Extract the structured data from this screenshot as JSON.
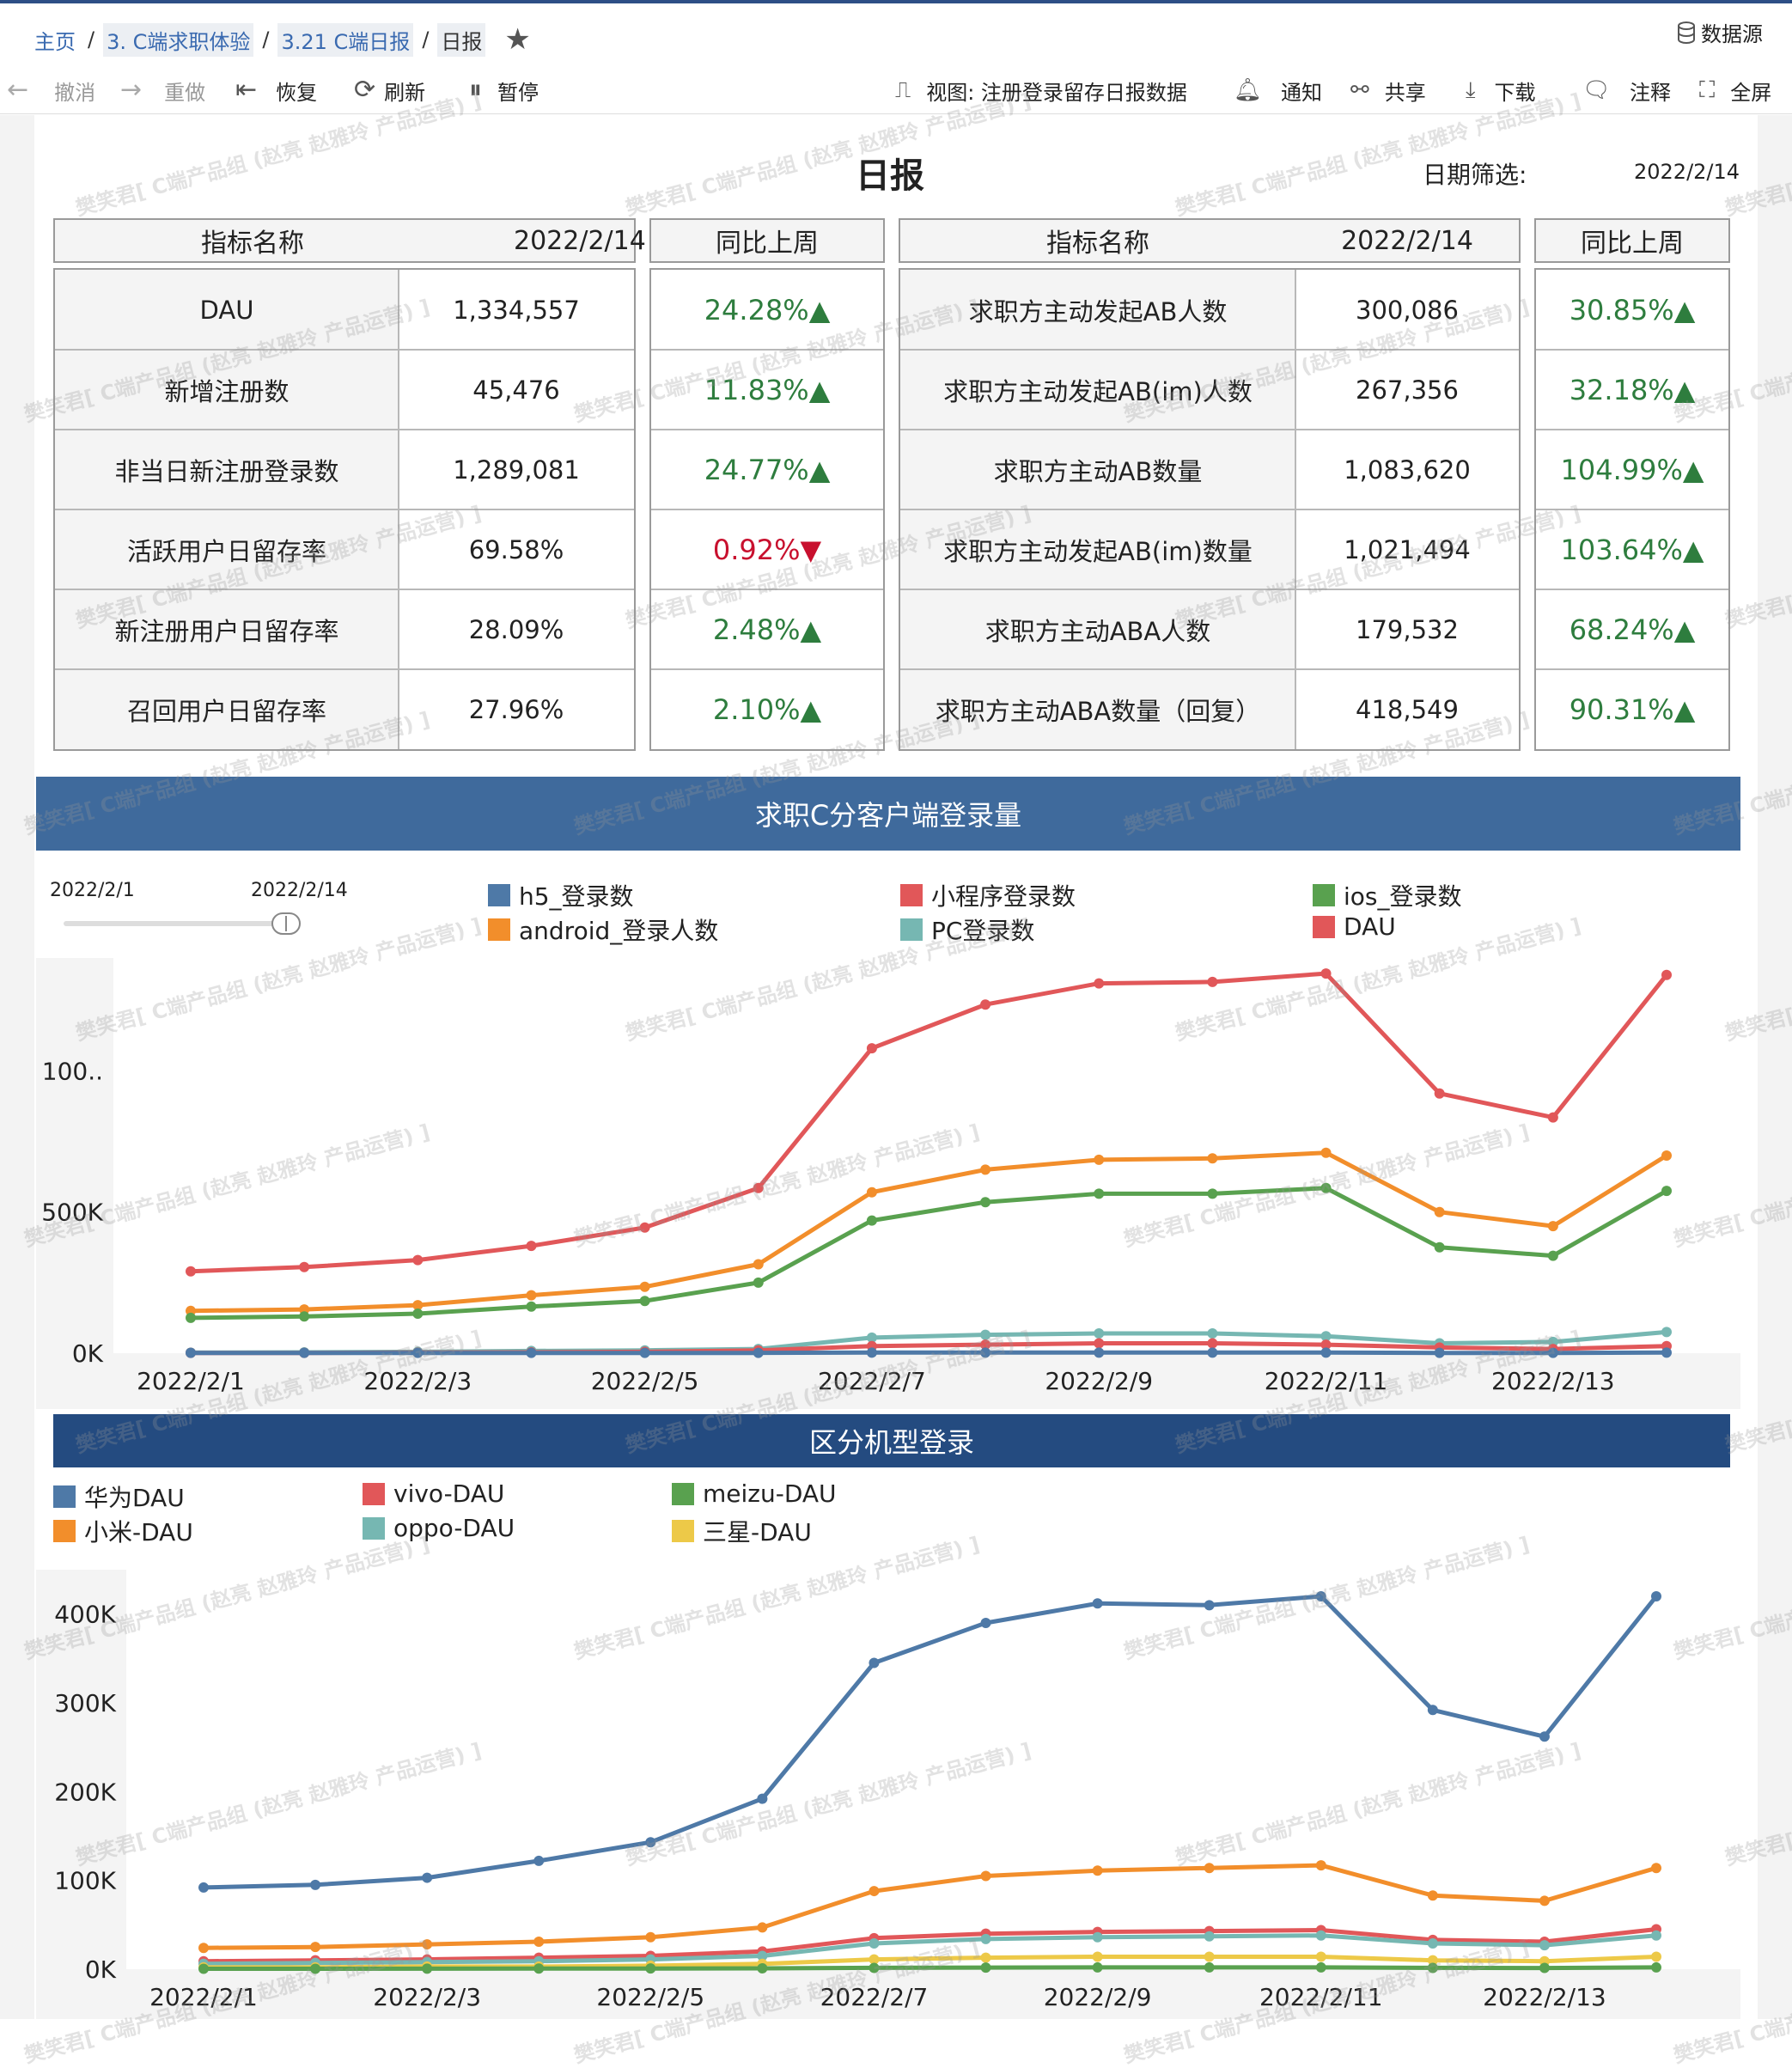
{
  "breadcrumb": {
    "home": "主页",
    "level1": "3. C端求职体验",
    "level2": "3.21 C端日报",
    "current": "日报",
    "separator": "/"
  },
  "datasource_label": "数据源",
  "toolbar": {
    "undo": "撤消",
    "redo": "重做",
    "revert": "恢复",
    "refresh": "刷新",
    "pause": "暂停",
    "view": "视图: 注册登录留存日报数据",
    "notify": "通知",
    "share": "共享",
    "download": "下载",
    "comment": "注释",
    "fullscreen": "全屏"
  },
  "report": {
    "title": "日报",
    "date_filter_label": "日期筛选:",
    "date_filter_value": "2022/2/14"
  },
  "metrics_left": {
    "header_name": "指标名称",
    "header_date": "2022/2/14",
    "header_wow": "同比上周",
    "rows": [
      {
        "name": "DAU",
        "value": "1,334,557",
        "wow": "24.28%▲",
        "dir": "up"
      },
      {
        "name": "新增注册数",
        "value": "45,476",
        "wow": "11.83%▲",
        "dir": "up"
      },
      {
        "name": "非当日新注册登录数",
        "value": "1,289,081",
        "wow": "24.77%▲",
        "dir": "up"
      },
      {
        "name": "活跃用户日留存率",
        "value": "69.58%",
        "wow": "0.92%▼",
        "dir": "down"
      },
      {
        "name": "新注册用户日留存率",
        "value": "28.09%",
        "wow": "2.48%▲",
        "dir": "up"
      },
      {
        "name": "召回用户日留存率",
        "value": "27.96%",
        "wow": "2.10%▲",
        "dir": "up"
      }
    ]
  },
  "metrics_right": {
    "header_name": "指标名称",
    "header_date": "2022/2/14",
    "header_wow": "同比上周",
    "rows": [
      {
        "name": "求职方主动发起AB人数",
        "value": "300,086",
        "wow": "30.85%▲",
        "dir": "up"
      },
      {
        "name": "求职方主动发起AB(im)人数",
        "value": "267,356",
        "wow": "32.18%▲",
        "dir": "up"
      },
      {
        "name": "求职方主动AB数量",
        "value": "1,083,620",
        "wow": "104.99%▲",
        "dir": "up"
      },
      {
        "name": "求职方主动发起AB(im)数量",
        "value": "1,021,494",
        "wow": "103.64%▲",
        "dir": "up"
      },
      {
        "name": "求职方主动ABA人数",
        "value": "179,532",
        "wow": "68.24%▲",
        "dir": "up"
      },
      {
        "name": "求职方主动ABA数量（回复）",
        "value": "418,549",
        "wow": "90.31%▲",
        "dir": "up"
      }
    ]
  },
  "chart1_header": "求职C分客户端登录量",
  "chart1_slider": {
    "start": "2022/2/1",
    "end": "2022/2/14"
  },
  "chart2_header": "区分机型登录",
  "watermark_text": "樊笑君[ C端产品组 (赵亮 赵雅玲 产品运营) ]",
  "colors": {
    "banner1": "#3f6a9c",
    "banner2": "#244b80",
    "blue": "#4e79a7",
    "orange": "#f28e2b",
    "red": "#e15759",
    "teal": "#76b7b2",
    "green": "#59a14f",
    "yellow": "#edc948",
    "up": "#2e7d3e",
    "down": "#c8102e"
  },
  "chart_data": [
    {
      "type": "line",
      "title": "求职C分客户端登录量",
      "x": [
        "2022/2/1",
        "2022/2/2",
        "2022/2/3",
        "2022/2/4",
        "2022/2/5",
        "2022/2/6",
        "2022/2/7",
        "2022/2/8",
        "2022/2/9",
        "2022/2/10",
        "2022/2/11",
        "2022/2/12",
        "2022/2/13",
        "2022/2/14"
      ],
      "x_tick_labels": [
        "2022/2/1",
        "2022/2/3",
        "2022/2/5",
        "2022/2/7",
        "2022/2/9",
        "2022/2/11",
        "2022/2/13"
      ],
      "y_tick_labels": [
        "0K",
        "500K",
        "100.."
      ],
      "y_ticks": [
        0,
        500000,
        1000000
      ],
      "ylim": [
        0,
        1400000
      ],
      "legend": [
        {
          "name": "h5_登录数",
          "color": "#4e79a7"
        },
        {
          "name": "android_登录人数",
          "color": "#f28e2b"
        },
        {
          "name": "小程序登录数",
          "color": "#e15759"
        },
        {
          "name": "PC登录数",
          "color": "#76b7b2"
        },
        {
          "name": "ios_登录数",
          "color": "#59a14f"
        },
        {
          "name": "DAU",
          "color": "#e15759"
        }
      ],
      "series": [
        {
          "name": "DAU",
          "color": "#e15759",
          "values": [
            290000,
            305000,
            330000,
            380000,
            445000,
            585000,
            1080000,
            1235000,
            1310000,
            1315000,
            1345000,
            920000,
            835000,
            1340000
          ]
        },
        {
          "name": "android_登录人数",
          "color": "#f28e2b",
          "values": [
            150000,
            155000,
            170000,
            205000,
            235000,
            315000,
            570000,
            650000,
            685000,
            690000,
            710000,
            500000,
            450000,
            700000
          ]
        },
        {
          "name": "ios_登录数",
          "color": "#59a14f",
          "values": [
            125000,
            130000,
            140000,
            165000,
            185000,
            250000,
            470000,
            535000,
            565000,
            565000,
            585000,
            375000,
            345000,
            575000
          ]
        },
        {
          "name": "PC登录数",
          "color": "#76b7b2",
          "values": [
            2000,
            3000,
            5000,
            8000,
            10000,
            15000,
            55000,
            65000,
            70000,
            70000,
            60000,
            35000,
            40000,
            75000
          ]
        },
        {
          "name": "小程序登录数",
          "color": "#e15759",
          "values": [
            1000,
            1000,
            2000,
            3000,
            5000,
            10000,
            25000,
            30000,
            35000,
            35000,
            30000,
            20000,
            15000,
            25000
          ]
        },
        {
          "name": "h5_登录数",
          "color": "#4e79a7",
          "values": [
            1000,
            1000,
            1000,
            1000,
            1000,
            1000,
            2000,
            2000,
            2000,
            2000,
            2000,
            1000,
            1000,
            2000
          ]
        }
      ]
    },
    {
      "type": "line",
      "title": "区分机型登录",
      "x": [
        "2022/2/1",
        "2022/2/2",
        "2022/2/3",
        "2022/2/4",
        "2022/2/5",
        "2022/2/6",
        "2022/2/7",
        "2022/2/8",
        "2022/2/9",
        "2022/2/10",
        "2022/2/11",
        "2022/2/12",
        "2022/2/13",
        "2022/2/14"
      ],
      "x_tick_labels": [
        "2022/2/1",
        "2022/2/3",
        "2022/2/5",
        "2022/2/7",
        "2022/2/9",
        "2022/2/11",
        "2022/2/13"
      ],
      "y_tick_labels": [
        "0K",
        "100K",
        "200K",
        "300K",
        "400K"
      ],
      "y_ticks": [
        0,
        100000,
        200000,
        300000,
        400000
      ],
      "ylim": [
        0,
        450000
      ],
      "legend": [
        {
          "name": "华为DAU",
          "color": "#4e79a7"
        },
        {
          "name": "小米-DAU",
          "color": "#f28e2b"
        },
        {
          "name": "vivo-DAU",
          "color": "#e15759"
        },
        {
          "name": "oppo-DAU",
          "color": "#76b7b2"
        },
        {
          "name": "meizu-DAU",
          "color": "#59a14f"
        },
        {
          "name": "三星-DAU",
          "color": "#edc948"
        }
      ],
      "series": [
        {
          "name": "华为DAU",
          "color": "#4e79a7",
          "values": [
            92000,
            95000,
            103000,
            122000,
            143000,
            192000,
            345000,
            390000,
            412000,
            410000,
            420000,
            292000,
            262000,
            420000
          ]
        },
        {
          "name": "小米-DAU",
          "color": "#f28e2b",
          "values": [
            24000,
            25000,
            28000,
            31000,
            36000,
            47000,
            88000,
            105000,
            111000,
            114000,
            117000,
            83000,
            77000,
            114000
          ]
        },
        {
          "name": "vivo-DAU",
          "color": "#e15759",
          "values": [
            9000,
            10000,
            11000,
            13000,
            15000,
            20000,
            35000,
            40000,
            42000,
            43000,
            44000,
            33000,
            31000,
            45000
          ]
        },
        {
          "name": "oppo-DAU",
          "color": "#76b7b2",
          "values": [
            6000,
            7000,
            8000,
            9000,
            11000,
            15000,
            29000,
            34000,
            36000,
            37000,
            38000,
            29000,
            27000,
            38000
          ]
        },
        {
          "name": "三星-DAU",
          "color": "#edc948",
          "values": [
            2000,
            2000,
            3000,
            3000,
            4000,
            6000,
            11000,
            13000,
            14000,
            14000,
            14000,
            10000,
            9000,
            14000
          ]
        },
        {
          "name": "meizu-DAU",
          "color": "#59a14f",
          "values": [
            500,
            500,
            600,
            700,
            800,
            1000,
            1500,
            1800,
            2000,
            2000,
            2000,
            1500,
            1400,
            2000
          ]
        }
      ]
    }
  ]
}
